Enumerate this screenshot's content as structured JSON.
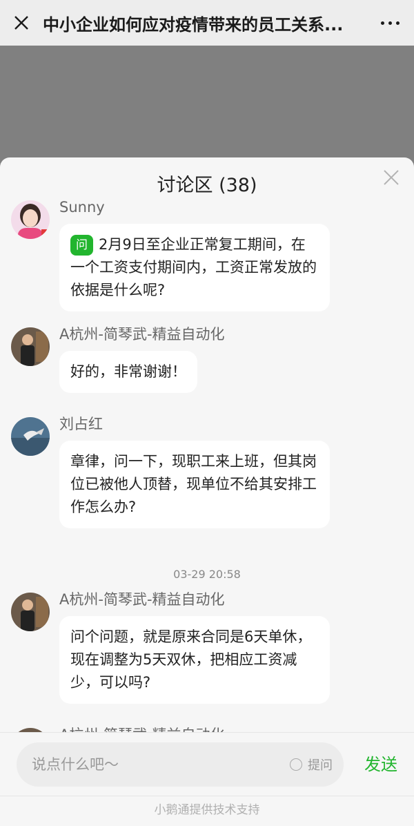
{
  "topbar": {
    "title": "中小企业如何应对疫情带来的员工关系..."
  },
  "panel": {
    "title": "讨论区 (38)"
  },
  "messages": [
    {
      "name": "Sunny",
      "tag": "问",
      "text": "2月9日至企业正常复工期间，在一个工资支付期间内，工资正常发放的依据是什么呢?"
    },
    {
      "name": "A杭州-简琴武-精益自动化",
      "text": "好的，非常谢谢！"
    },
    {
      "name": "刘占红",
      "text": "章律，问一下，现职工来上班，但其岗位已被他人顶替，现单位不给其安排工作怎么办?"
    },
    {
      "timestamp": "03-29 20:58"
    },
    {
      "name": "A杭州-简琴武-精益自动化",
      "text": "问个问题，就是原来合同是6天单休，现在调整为5天双休，把相应工资减少，可以吗?"
    },
    {
      "name": "A杭州-简琴武-精益自动化"
    }
  ],
  "input": {
    "placeholder": "说点什么吧～",
    "ask_label": "提问",
    "send_label": "发送"
  },
  "footer": {
    "text": "小鹅通提供技术支持"
  },
  "colors": {
    "accent": "#22b52e",
    "panel_bg": "#f6f6f6",
    "bubble_bg": "#ffffff",
    "overlay": "#808080"
  }
}
